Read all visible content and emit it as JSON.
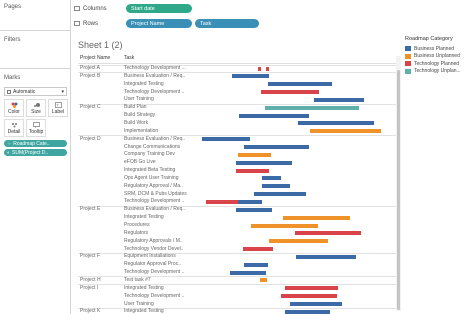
{
  "left": {
    "pages_label": "Pages",
    "filters_label": "Filters",
    "marks_label": "Marks",
    "mark_type": "Automatic",
    "buttons": [
      "Color",
      "Size",
      "Label",
      "Detail",
      "Tooltip"
    ],
    "pills": [
      "Roadmap Cate..",
      "SUM(Project D.."
    ]
  },
  "shelves": {
    "columns_label": "Columns",
    "rows_label": "Rows",
    "columns_pill": "Start date",
    "rows_pills": [
      "Project Name",
      "Task"
    ]
  },
  "sheet_title": "Sheet 1 (2)",
  "table": {
    "col_project": "Project Name",
    "col_task": "Task"
  },
  "legend": {
    "title": "Roadmap Category",
    "items": [
      {
        "label": "Business Planned",
        "color": "#3b6aa6"
      },
      {
        "label": "Business Unplanned",
        "color": "#f0922a"
      },
      {
        "label": "Technology Planned",
        "color": "#d9444b"
      },
      {
        "label": "Technology Unplan...",
        "color": "#5fb0ab"
      }
    ]
  },
  "rows": [
    {
      "p": "Project A",
      "t": "Technology Development ...",
      "bars": [
        [
          258,
          261,
          "#d9444b"
        ],
        [
          266,
          269,
          "#d9444b"
        ]
      ]
    },
    {
      "p": "Project B",
      "t": "Business Evaluation / Req..",
      "bars": [
        [
          232,
          269,
          "#3b6aa6"
        ]
      ]
    },
    {
      "p": "",
      "t": "Integrated Testing",
      "bars": [
        [
          268,
          332,
          "#3b6aa6"
        ]
      ]
    },
    {
      "p": "",
      "t": "Technology Development ..",
      "bars": [
        [
          261,
          319,
          "#d9444b"
        ]
      ]
    },
    {
      "p": "",
      "t": "User Training",
      "bars": [
        [
          314,
          364,
          "#3b6aa6"
        ]
      ]
    },
    {
      "p": "Project C",
      "t": "Build Plan",
      "bars": [
        [
          265,
          359,
          "#5fb0ab"
        ]
      ]
    },
    {
      "p": "",
      "t": "Build Strategy",
      "bars": [
        [
          239,
          309,
          "#3b6aa6"
        ]
      ]
    },
    {
      "p": "",
      "t": "Build Work",
      "bars": [
        [
          298,
          374,
          "#3b6aa6"
        ]
      ]
    },
    {
      "p": "",
      "t": "Implementation",
      "bars": [
        [
          310,
          381,
          "#f0922a"
        ]
      ]
    },
    {
      "p": "Project D",
      "t": "Business Evaluation / Req..",
      "bars": [
        [
          202,
          250,
          "#3b6aa6"
        ]
      ]
    },
    {
      "p": "",
      "t": "Change Communications",
      "bars": [
        [
          244,
          309,
          "#3b6aa6"
        ]
      ]
    },
    {
      "p": "",
      "t": "Company Training Dev",
      "bars": [
        [
          238,
          271,
          "#f0922a"
        ]
      ]
    },
    {
      "p": "",
      "t": "eFOB Go Live",
      "bars": [
        [
          236,
          292,
          "#3b6aa6"
        ]
      ]
    },
    {
      "p": "",
      "t": "Integrated Beta Testing",
      "bars": [
        [
          236,
          269,
          "#d9444b"
        ]
      ]
    },
    {
      "p": "",
      "t": "Ops Agent User Training",
      "bars": [
        [
          262,
          281,
          "#3b6aa6"
        ]
      ]
    },
    {
      "p": "",
      "t": "Regulatory Approval / Ma..",
      "bars": [
        [
          262,
          290,
          "#3b6aa6"
        ]
      ]
    },
    {
      "p": "",
      "t": "SRM, DCM & Pubs Updates",
      "bars": [
        [
          254,
          306,
          "#3b6aa6"
        ]
      ]
    },
    {
      "p": "",
      "t": "Technology Development ..",
      "bars": [
        [
          206,
          239,
          "#d9444b"
        ],
        [
          238,
          262,
          "#3b6aa6"
        ]
      ]
    },
    {
      "p": "Project E",
      "t": "Business Evaluation / Req..",
      "bars": [
        [
          236,
          272,
          "#3b6aa6"
        ]
      ]
    },
    {
      "p": "",
      "t": "Integrated Testing",
      "bars": [
        [
          283,
          350,
          "#f0922a"
        ]
      ]
    },
    {
      "p": "",
      "t": "Procedures",
      "bars": [
        [
          251,
          318,
          "#f0922a"
        ]
      ]
    },
    {
      "p": "",
      "t": "Regulators",
      "bars": [
        [
          295,
          361,
          "#d9444b"
        ]
      ]
    },
    {
      "p": "",
      "t": "Regulatory Approvals / M..",
      "bars": [
        [
          269,
          328,
          "#f0922a"
        ]
      ]
    },
    {
      "p": "",
      "t": "Technology Vendor Devel..",
      "bars": [
        [
          243,
          273,
          "#d9444b"
        ]
      ]
    },
    {
      "p": "Project F",
      "t": "Equipment Installations",
      "bars": [
        [
          296,
          356,
          "#3b6aa6"
        ]
      ]
    },
    {
      "p": "",
      "t": "Regulator Approval Proc..",
      "bars": [
        [
          244,
          268,
          "#3b6aa6"
        ]
      ]
    },
    {
      "p": "",
      "t": "Technology Development ..",
      "bars": [
        [
          230,
          266,
          "#3b6aa6"
        ]
      ]
    },
    {
      "p": "Project H",
      "t": "Test task #7",
      "bars": [
        [
          260,
          267,
          "#f0922a"
        ]
      ]
    },
    {
      "p": "Project I",
      "t": "Integrated Testing",
      "bars": [
        [
          285,
          338,
          "#d9444b"
        ]
      ]
    },
    {
      "p": "",
      "t": "Technology Development ..",
      "bars": [
        [
          281,
          337,
          "#d9444b"
        ]
      ]
    },
    {
      "p": "",
      "t": "User Training",
      "bars": [
        [
          290,
          342,
          "#3b6aa6"
        ]
      ]
    },
    {
      "p": "Project K",
      "t": "Integrated Testing",
      "bars": [
        [
          285,
          330,
          "#3b6aa6"
        ]
      ]
    }
  ]
}
